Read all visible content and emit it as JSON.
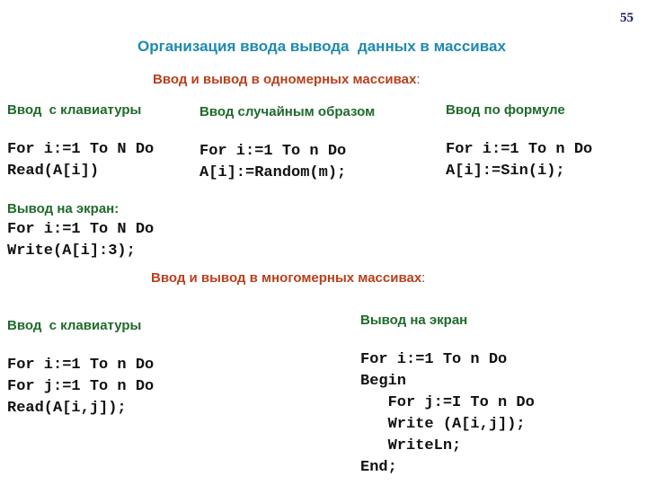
{
  "page_number": "55",
  "title": "Организация ввода вывода  данных в массивах",
  "one_dim": {
    "heading": "Ввод и вывод в одномерных массивах",
    "heading_suffix": ":",
    "columns": [
      {
        "label": "Ввод  с клавиатуры",
        "code": "For i:=1 To N Do\nRead(A[i])"
      },
      {
        "label": "Ввод случайным образом",
        "code": "For i:=1 To n Do\nA[i]:=Random(m);"
      },
      {
        "label": "Ввод по формуле",
        "code": "For i:=1 To n Do\nA[i]:=Sin(i);"
      }
    ],
    "output": {
      "label": "Вывод на экран:",
      "code": "For i:=1 To N Do\nWrite(A[i]:3);"
    }
  },
  "multi_dim": {
    "heading": "Ввод и вывод в многомерных массивах",
    "heading_suffix": ":",
    "input": {
      "label": "Ввод  с клавиатуры",
      "code": "For i:=1 To n Do\nFor j:=1 To n Do\nRead(A[i,j]);"
    },
    "output": {
      "label": "Вывод на экран",
      "code": "For i:=1 To n Do\nBegin\n   For j:=I To n Do\n   Write (A[i,j]);\n   WriteLn;\nEnd;"
    }
  }
}
